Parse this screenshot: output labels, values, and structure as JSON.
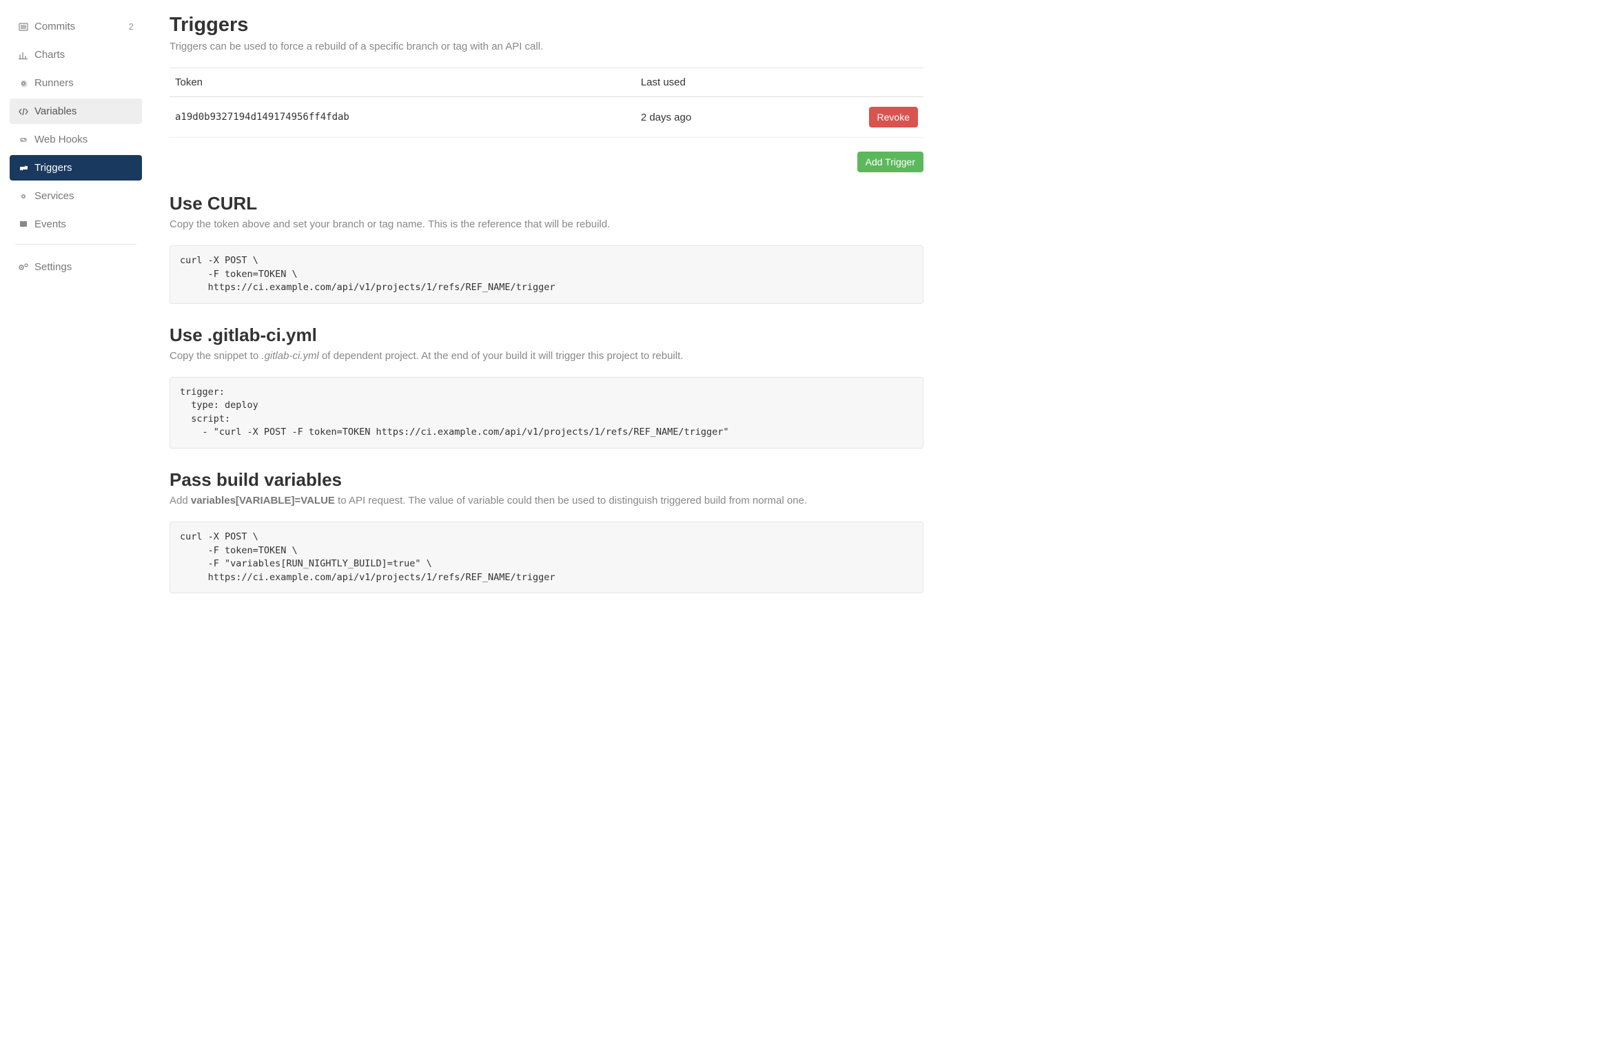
{
  "sidebar": {
    "items": [
      {
        "label": "Commits",
        "badge": "2"
      },
      {
        "label": "Charts"
      },
      {
        "label": "Runners"
      },
      {
        "label": "Variables"
      },
      {
        "label": "Web Hooks"
      },
      {
        "label": "Triggers"
      },
      {
        "label": "Services"
      },
      {
        "label": "Events"
      }
    ],
    "settings_label": "Settings"
  },
  "page": {
    "title": "Triggers",
    "lead": "Triggers can be used to force a rebuild of a specific branch or tag with an API call."
  },
  "table": {
    "col_token": "Token",
    "col_last_used": "Last used",
    "rows": [
      {
        "token": "a19d0b9327194d149174956ff4fdab",
        "last_used": "2 days ago",
        "revoke_label": "Revoke"
      }
    ],
    "add_trigger_label": "Add Trigger"
  },
  "curl_section": {
    "title": "Use CURL",
    "lead": "Copy the token above and set your branch or tag name. This is the reference that will be rebuild.",
    "code": "curl -X POST \\\n     -F token=TOKEN \\\n     https://ci.example.com/api/v1/projects/1/refs/REF_NAME/trigger"
  },
  "yml_section": {
    "title": "Use .gitlab-ci.yml",
    "lead_pre": "Copy the snippet to ",
    "lead_italic": ".gitlab-ci.yml",
    "lead_post": " of dependent project. At the end of your build it will trigger this project to rebuilt.",
    "code": "trigger:\n  type: deploy\n  script:\n    - \"curl -X POST -F token=TOKEN https://ci.example.com/api/v1/projects/1/refs/REF_NAME/trigger\""
  },
  "vars_section": {
    "title": "Pass build variables",
    "lead_pre": "Add ",
    "lead_bold": "variables[VARIABLE]=VALUE",
    "lead_post": " to API request. The value of variable could then be used to distinguish triggered build from normal one.",
    "code": "curl -X POST \\\n     -F token=TOKEN \\\n     -F \"variables[RUN_NIGHTLY_BUILD]=true\" \\\n     https://ci.example.com/api/v1/projects/1/refs/REF_NAME/trigger"
  }
}
